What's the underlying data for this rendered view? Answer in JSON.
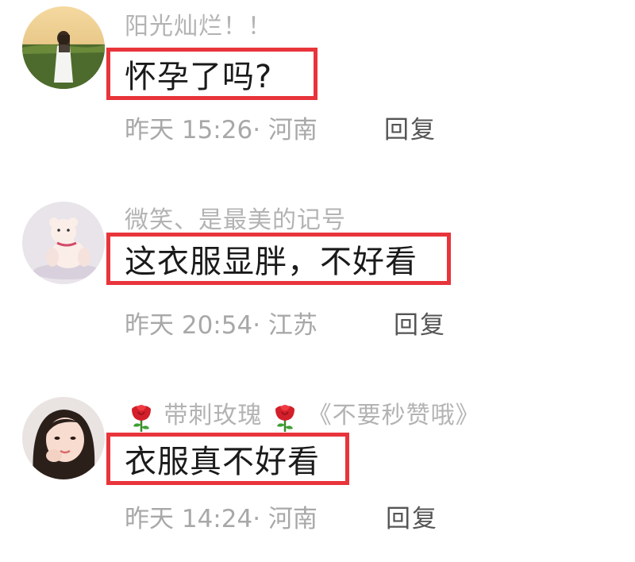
{
  "comments": [
    {
      "username": "阳光灿烂！！",
      "text": "怀孕了吗?",
      "meta": "昨天 15:26· 河南",
      "reply_label": "回复"
    },
    {
      "username": "微笑、是最美的记号",
      "text": "这衣服显胖，不好看",
      "meta": "昨天 20:54· 江苏",
      "reply_label": "回复"
    },
    {
      "username_name": "带刺玫瑰",
      "username_suffix": "《不要秒赞哦》",
      "username_icons": [
        "rose-icon",
        "rose-icon"
      ],
      "text": "衣服真不好看",
      "meta": "昨天 14:24· 河南",
      "reply_label": "回复"
    }
  ],
  "colors": {
    "highlight_border": "#e8343b",
    "username": "#b3b3b3",
    "meta": "#a8a8a8",
    "reply": "#555555",
    "text": "#1a1a1a"
  }
}
